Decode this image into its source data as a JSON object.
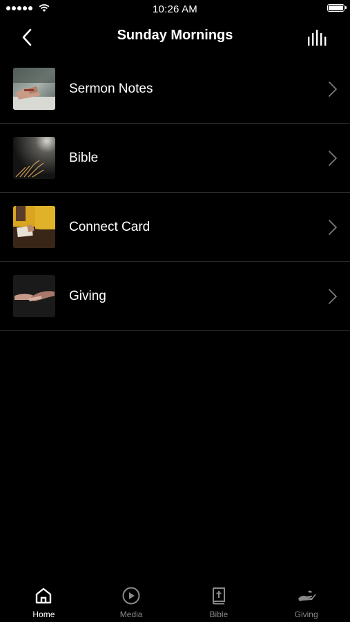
{
  "status_bar": {
    "time": "10:26 AM"
  },
  "nav": {
    "title": "Sunday Mornings",
    "back_icon": "chevron-left-icon",
    "audio_icon": "equalizer-icon"
  },
  "items": [
    {
      "label": "Sermon Notes",
      "icon": "chevron-right-icon"
    },
    {
      "label": "Bible",
      "icon": "chevron-right-icon"
    },
    {
      "label": "Connect Card",
      "icon": "chevron-right-icon"
    },
    {
      "label": "Giving",
      "icon": "chevron-right-icon"
    }
  ],
  "tabs": [
    {
      "label": "Home",
      "icon": "home-icon",
      "active": true
    },
    {
      "label": "Media",
      "icon": "play-circle-icon",
      "active": false
    },
    {
      "label": "Bible",
      "icon": "bible-icon",
      "active": false
    },
    {
      "label": "Giving",
      "icon": "giving-hand-icon",
      "active": false
    }
  ],
  "colors": {
    "background": "#000000",
    "text": "#ffffff",
    "divider": "#2a2a2a",
    "inactive_tab": "#8a8a8a"
  }
}
